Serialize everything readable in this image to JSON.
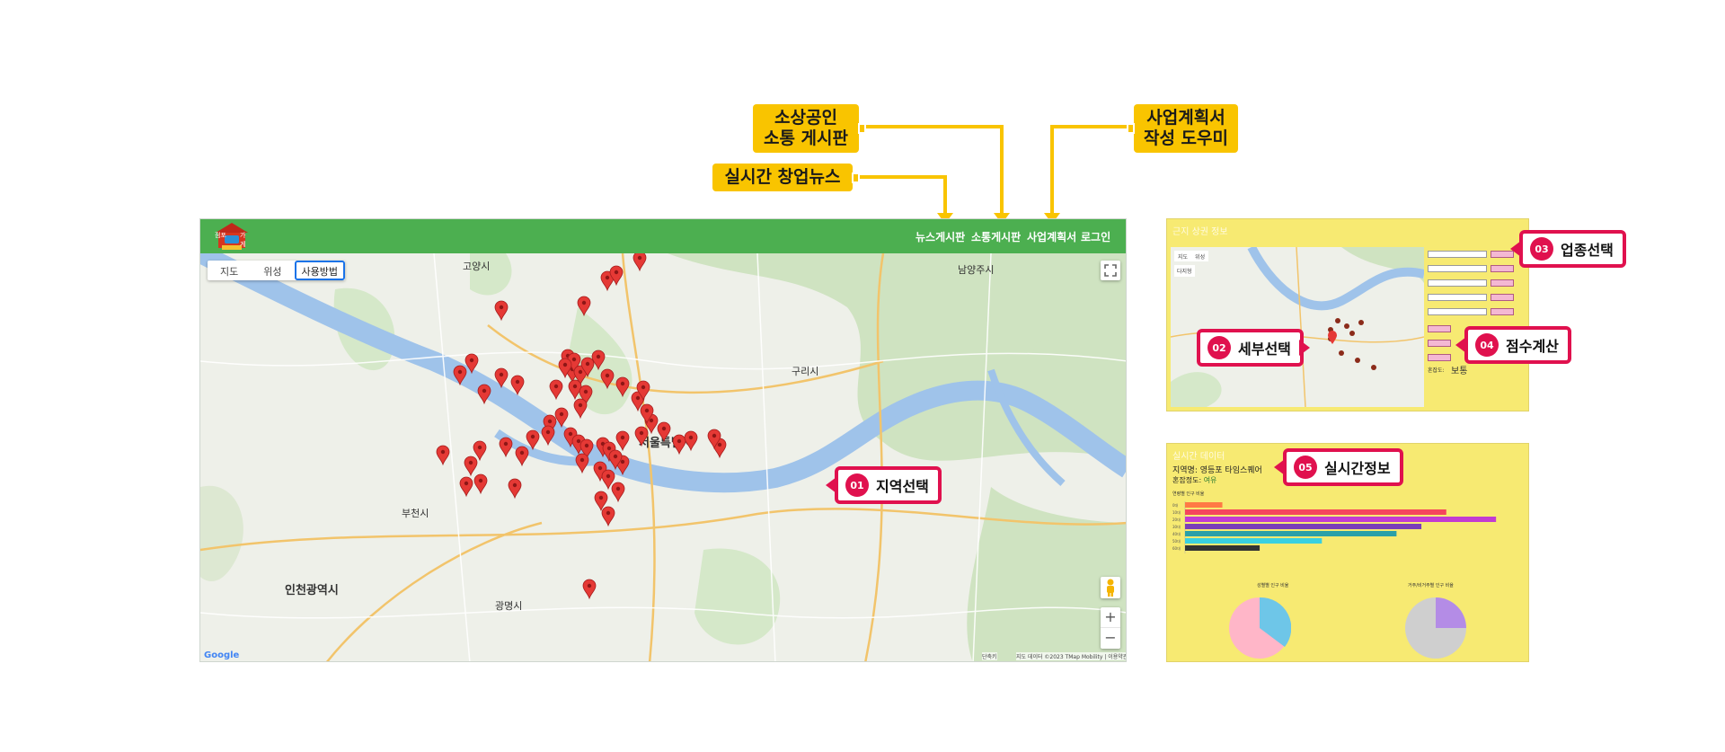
{
  "callouts_top": {
    "board": [
      "소상공인",
      "소통 게시판"
    ],
    "news": "실시간 창업뉴스",
    "business_plan": [
      "사업계획서",
      "작성 도우미"
    ]
  },
  "app": {
    "logo_text": [
      "점포",
      "가게"
    ],
    "nav": [
      "뉴스게시판",
      "소통게시판",
      "사업계획서",
      "로그인"
    ],
    "map_types": [
      "지도",
      "위성",
      "사용방법"
    ],
    "map_labels": {
      "goyang": "고양시",
      "namyangju": "남양주시",
      "guri": "구리시",
      "seoul": "서울특별시",
      "bucheon": "부천시",
      "incheon": "인천광역시",
      "gwangmyeong": "광명시"
    },
    "attribution": "지도 데이터 ©2023 TMap Mobility | 이용약관",
    "attribution_left": "단축키",
    "google": "Google",
    "zoom_in": "+",
    "zoom_out": "−"
  },
  "callouts": {
    "c01": {
      "num": "01",
      "label": "지역선택"
    },
    "c02": {
      "num": "02",
      "label": "세부선택"
    },
    "c03": {
      "num": "03",
      "label": "업종선택"
    },
    "c04": {
      "num": "04",
      "label": "점수계산"
    },
    "c05": {
      "num": "05",
      "label": "실시간정보"
    }
  },
  "panel1": {
    "title": "근지 상권 정보",
    "map_types": [
      "지도",
      "위성"
    ],
    "satellite": "다지형",
    "congestion_label": "혼잡도:",
    "congestion_value": "보통"
  },
  "panel2": {
    "title": "실시간 데이터",
    "area_label": "지역명: 영등포 타임스퀘어",
    "congestion_label": "혼잡정도: ",
    "congestion_value": "여유",
    "bar_title": "연령별 인구 비율",
    "pie1_title": "성별별 인구 비율",
    "pie2_title": "거주/비거주별 인구 비율"
  },
  "colors": {
    "yellow": "#f9c400",
    "pink": "#e0114e",
    "navbar": "#4caf50",
    "panel": "#f7ea72"
  },
  "chart_data": {
    "type": "bar",
    "title": "연령별 인구 비율",
    "categories": [
      "0대",
      "10대",
      "20대",
      "30대",
      "40대",
      "50대",
      "60대"
    ],
    "values": [
      3,
      21,
      25,
      19,
      17,
      11,
      6
    ]
  }
}
